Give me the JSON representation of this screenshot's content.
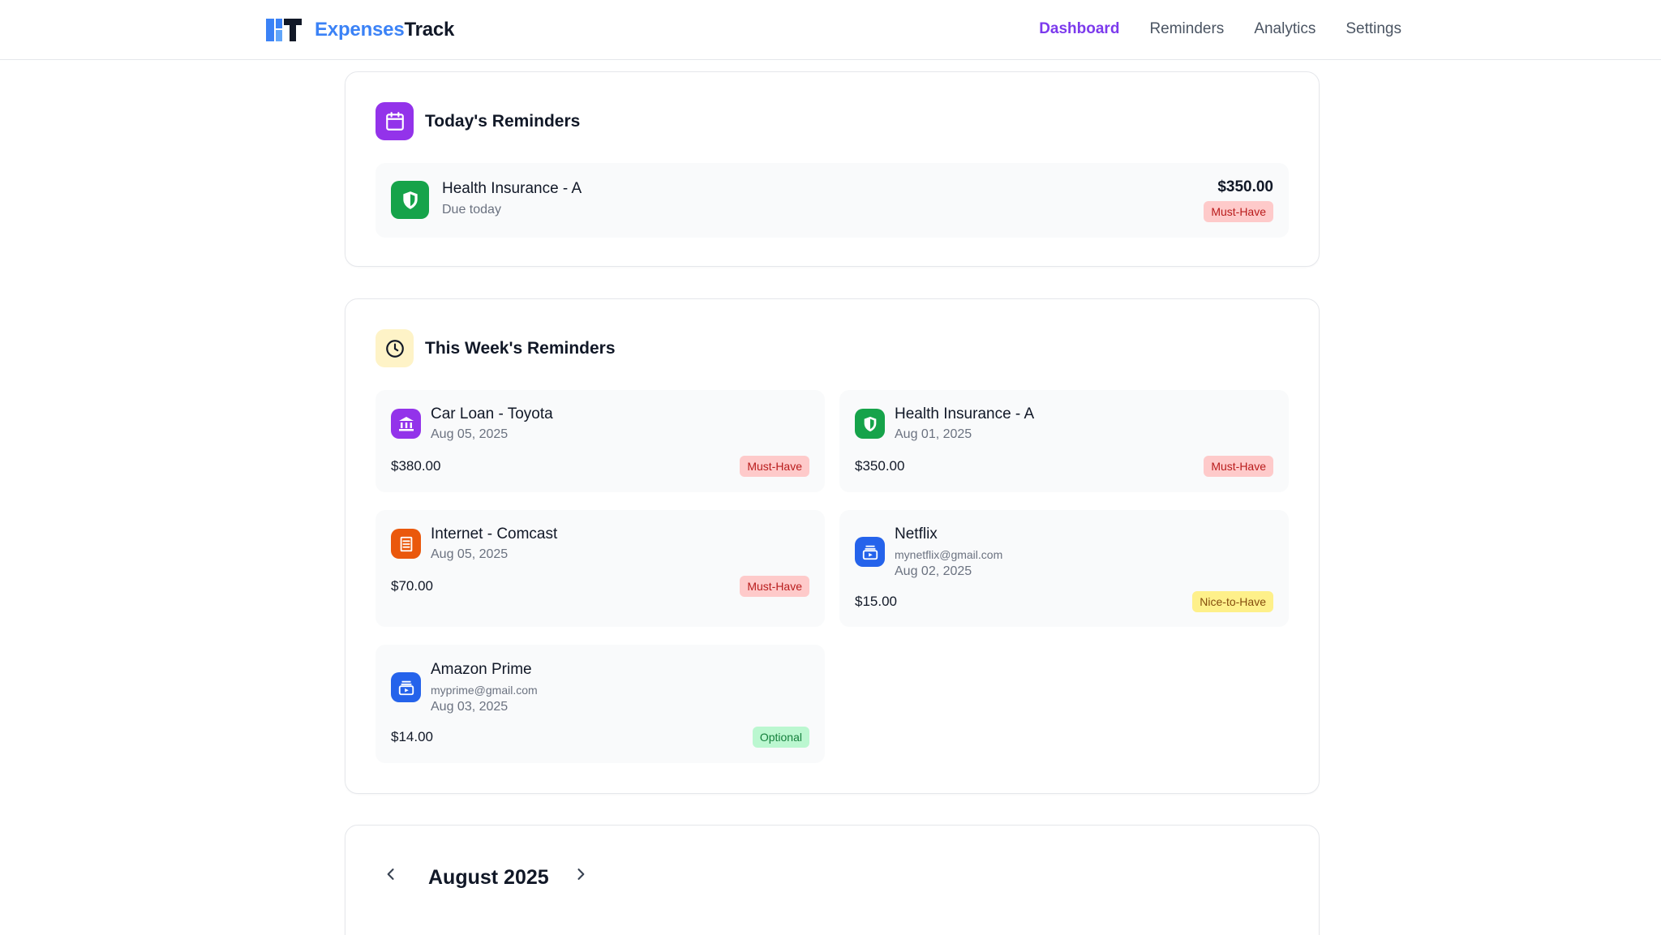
{
  "app": {
    "brand_part1": "Expenses",
    "brand_part2": "Track"
  },
  "nav": {
    "items": [
      {
        "label": "Dashboard",
        "active": true
      },
      {
        "label": "Reminders",
        "active": false
      },
      {
        "label": "Analytics",
        "active": false
      },
      {
        "label": "Settings",
        "active": false
      }
    ]
  },
  "today": {
    "title": "Today's Reminders",
    "icon": "calendar-icon",
    "items": [
      {
        "name": "Health Insurance - A",
        "sub": "Due today",
        "amount": "$350.00",
        "priority": "Must-Have",
        "icon": "shield-icon"
      }
    ]
  },
  "week": {
    "title": "This Week's Reminders",
    "icon": "clock-icon",
    "items": [
      {
        "name": "Car Loan - Toyota",
        "email": "",
        "date": "Aug 05, 2025",
        "amount": "$380.00",
        "priority": "Must-Have",
        "icon": "bank-icon"
      },
      {
        "name": "Health Insurance - A",
        "email": "",
        "date": "Aug 01, 2025",
        "amount": "$350.00",
        "priority": "Must-Have",
        "icon": "shield-icon"
      },
      {
        "name": "Internet - Comcast",
        "email": "",
        "date": "Aug 05, 2025",
        "amount": "$70.00",
        "priority": "Must-Have",
        "icon": "receipt-icon"
      },
      {
        "name": "Netflix",
        "email": "mynetflix@gmail.com",
        "date": "Aug 02, 2025",
        "amount": "$15.00",
        "priority": "Nice-to-Have",
        "icon": "subscription-icon"
      },
      {
        "name": "Amazon Prime",
        "email": "myprime@gmail.com",
        "date": "Aug 03, 2025",
        "amount": "$14.00",
        "priority": "Optional",
        "icon": "subscription-icon"
      }
    ]
  },
  "calendar": {
    "month_label": "August 2025"
  },
  "colors": {
    "accent": "#7c3aed",
    "brand_blue": "#3b82f6",
    "must_have_bg": "#fecaca",
    "nice_bg": "#fef08a",
    "optional_bg": "#bbf7d0"
  }
}
